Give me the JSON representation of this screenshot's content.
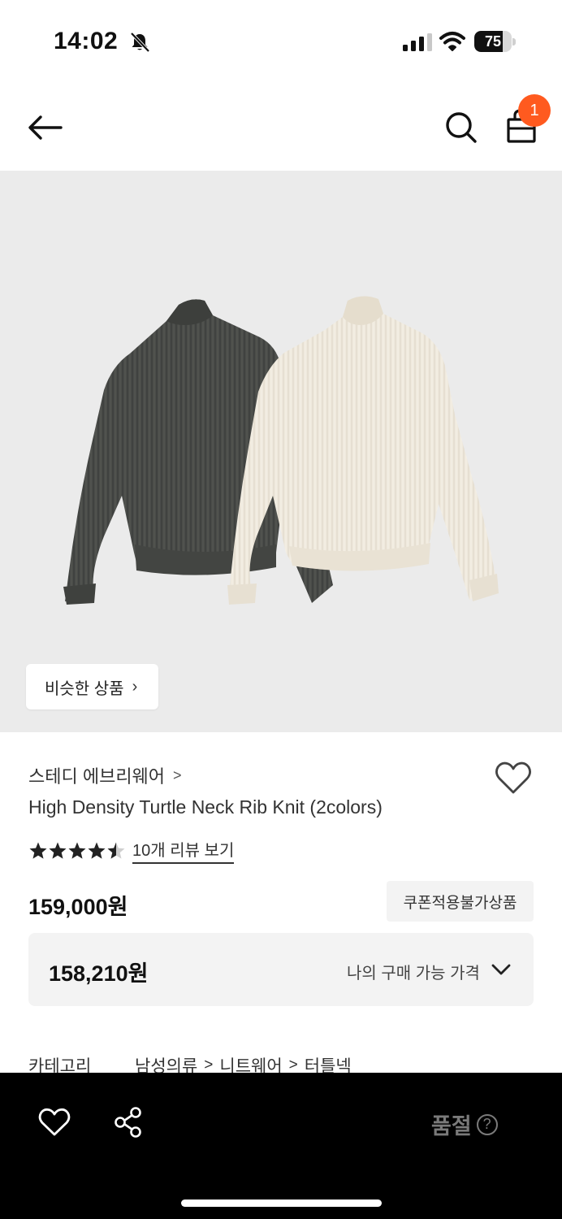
{
  "status_bar": {
    "time": "14:02",
    "battery_level": "75",
    "battery_fraction": 0.75
  },
  "header": {
    "cart_count": "1",
    "icons": [
      "back-arrow-icon",
      "search-icon",
      "shopping-bag-icon"
    ]
  },
  "hero": {
    "similar_products_label": "비슷한 상품",
    "chevron": "›"
  },
  "product": {
    "brand": "스테디 에브리웨어",
    "title": "High Density Turtle Neck Rib Knit (2colors)",
    "rating_value": 4.5,
    "rating_max": 5,
    "review_link": "10개 리뷰 보기",
    "price": "159,000원",
    "coupon_badge": "쿠폰적용불가상품",
    "my_price": "158,210원",
    "my_price_label": "나의 구매 가능 가격"
  },
  "category": {
    "label": "카테고리",
    "path": [
      "남성의류",
      "니트웨어",
      "터틀넥"
    ],
    "separator": ">"
  },
  "bottom_bar": {
    "status_label": "품절",
    "help_glyph": "?"
  },
  "colors": {
    "accent_badge": "#ff5a1f",
    "hero_bg": "#ebebeb",
    "bottom_bar_bg": "#000000",
    "disabled_text": "#7a7a7a"
  }
}
